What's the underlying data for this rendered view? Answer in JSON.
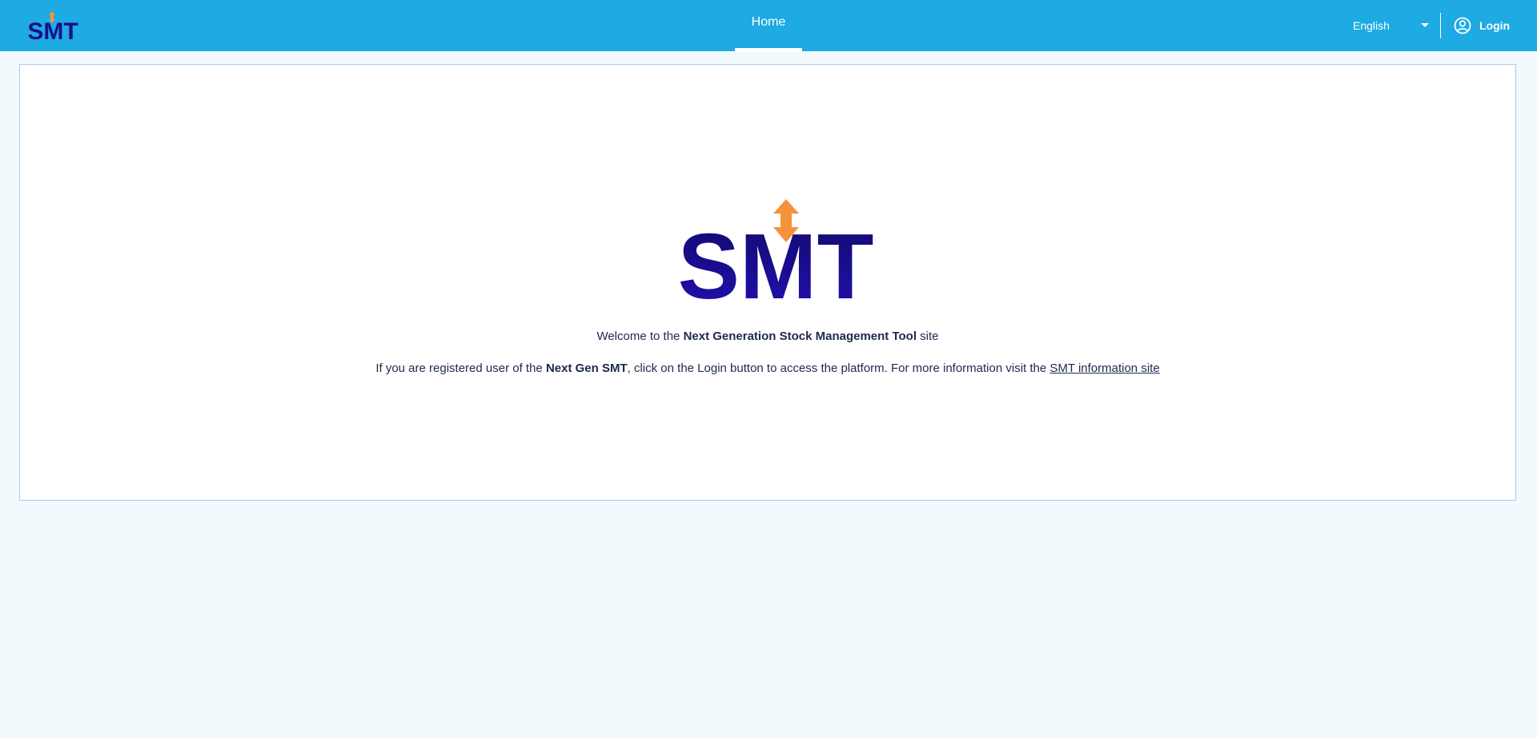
{
  "header": {
    "logo_text": "SMT",
    "nav_tab_home": "Home",
    "language": "English",
    "login_label": "Login",
    "colors": {
      "bar": "#1eaae2",
      "logo_navy": "#1a0f8a",
      "logo_arrow": "#f7923a"
    },
    "icons": [
      "smt-logo",
      "chevron-down-icon",
      "user-circle-icon"
    ]
  },
  "main": {
    "hero_logo_text": "SMT",
    "welcome_pre": "Welcome to the ",
    "welcome_bold": "Next Generation Stock Management Tool",
    "welcome_post": " site",
    "info_pre": "If you are registered user of the ",
    "info_bold": "Next Gen SMT",
    "info_mid": ", click on the Login button to access the platform. For more information visit the ",
    "info_link": "SMT information site"
  }
}
